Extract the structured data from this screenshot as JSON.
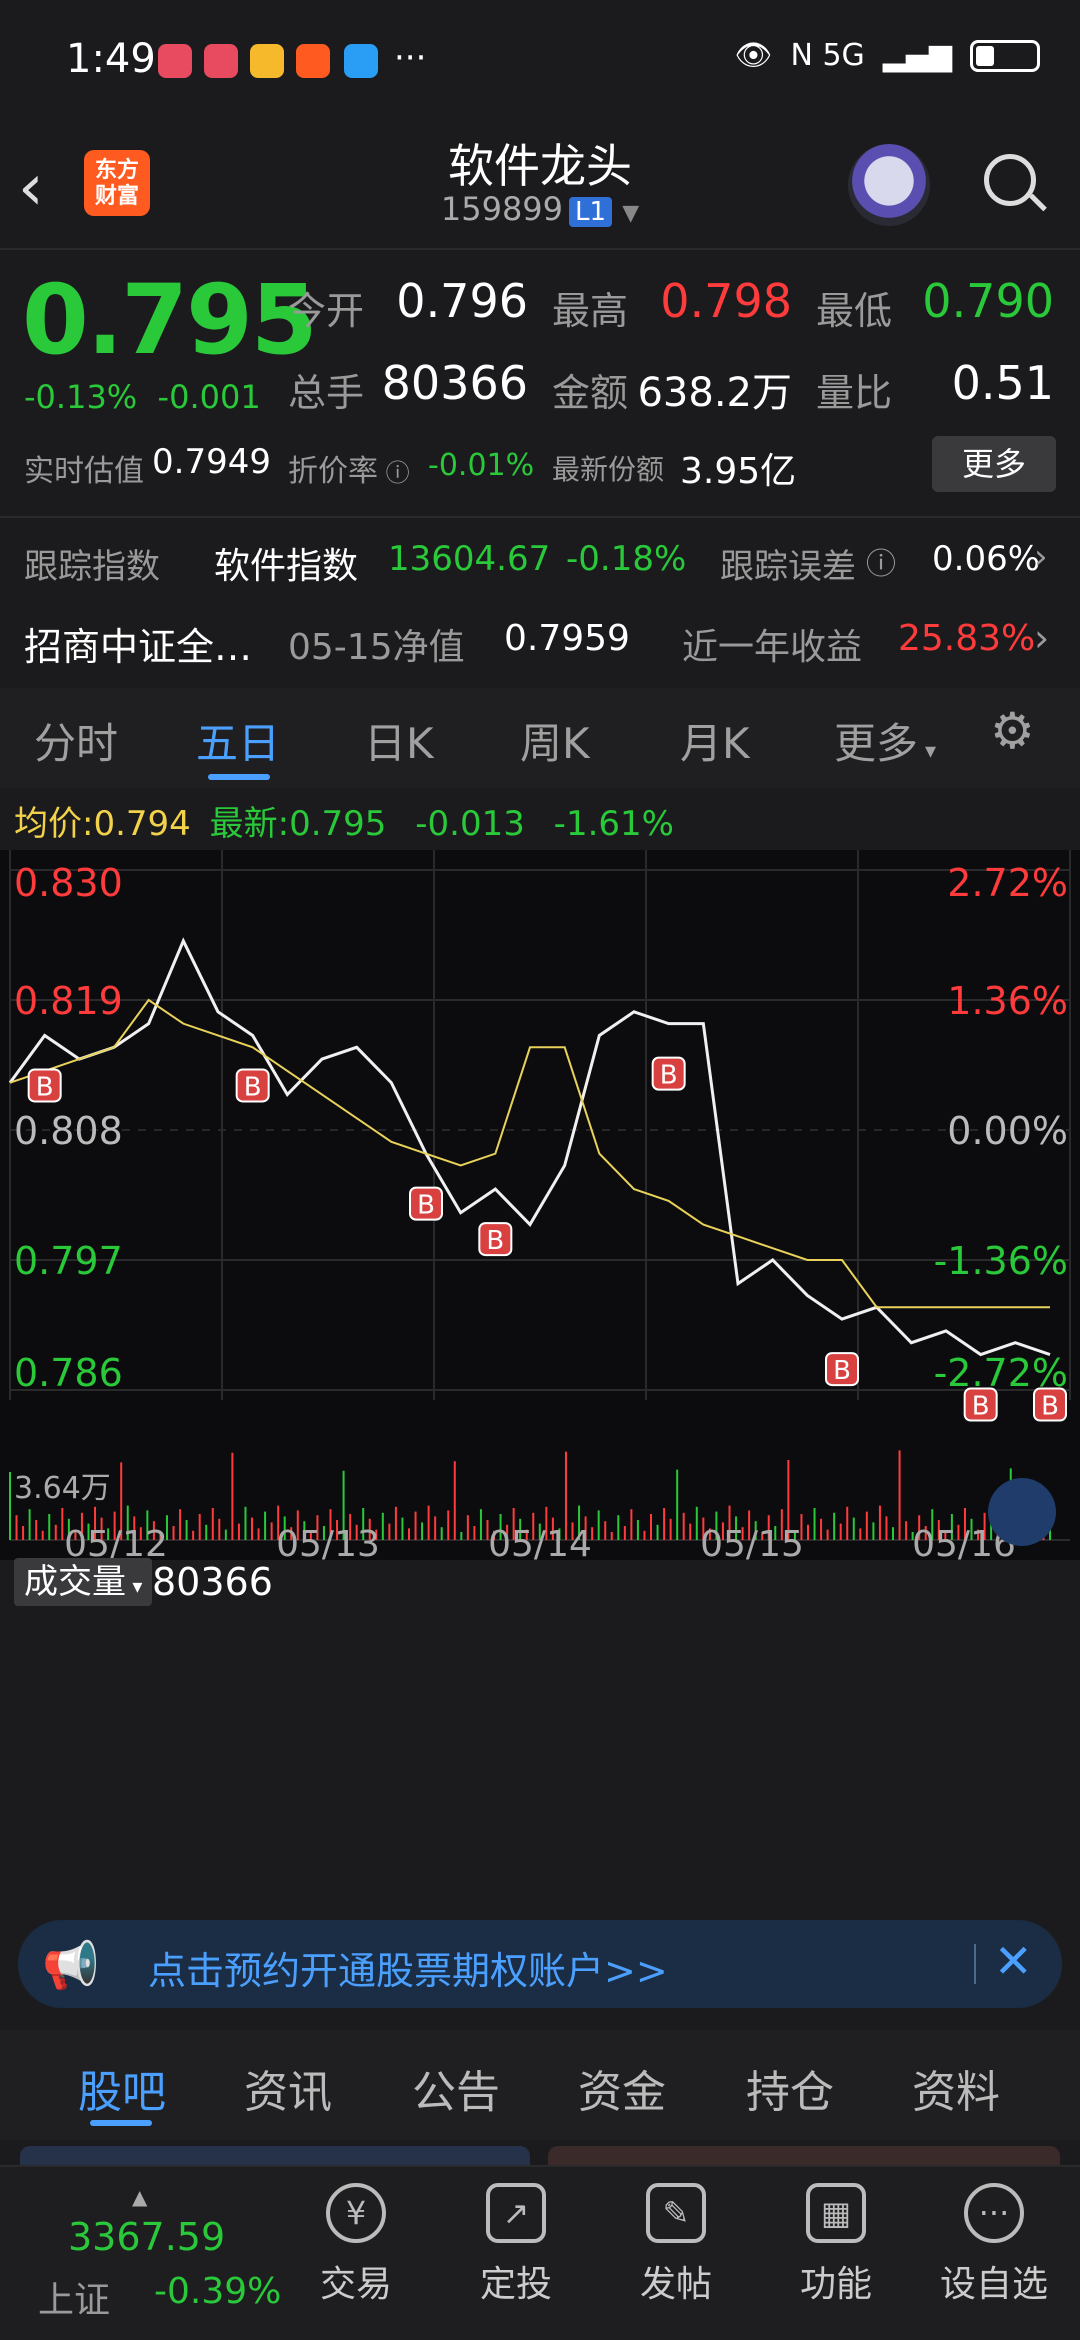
{
  "status": {
    "time": "1:49",
    "right_icons": "N  5G",
    "dots": "···"
  },
  "header": {
    "title": "软件龙头",
    "code": "159899",
    "level": "L1",
    "logo_line1": "东方",
    "logo_line2": "财富"
  },
  "quote": {
    "price": "0.795",
    "change_pct": "-0.13%",
    "change_abs": "-0.001",
    "open_label": "今开",
    "open": "0.796",
    "high_label": "最高",
    "high": "0.798",
    "low_label": "最低",
    "low": "0.790",
    "volume_label": "总手",
    "volume": "80366",
    "amount_label": "金额",
    "amount": "638.2万",
    "vol_ratio_label": "量比",
    "vol_ratio": "0.51",
    "iopv_label": "实时估值",
    "iopv": "0.7949",
    "discount_label": "折价率",
    "discount": "-0.01%",
    "shares_label": "最新份额",
    "shares": "3.95亿",
    "more": "更多"
  },
  "tracking": {
    "label": "跟踪指数",
    "index_name": "软件指数",
    "index_value": "13604.67",
    "index_change": "-0.18%",
    "error_label": "跟踪误差",
    "error_value": "0.06%"
  },
  "fund": {
    "name": "招商中证全…",
    "nav_label": "05-15净值",
    "nav": "0.7959",
    "yield_label": "近一年收益",
    "yield": "25.83%"
  },
  "chart_tabs": [
    "分时",
    "五日",
    "日K",
    "周K",
    "月K",
    "更多"
  ],
  "avg_row": {
    "avg_label": "均价:",
    "avg": "0.794",
    "latest_label": "最新:",
    "latest": "0.795",
    "chg": "-0.013",
    "chg_pct": "-1.61%"
  },
  "chart_data": {
    "type": "line",
    "y_labels_left": [
      "0.830",
      "0.819",
      "0.808",
      "0.797",
      "0.786"
    ],
    "y_labels_right": [
      "2.72%",
      "1.36%",
      "0.00%",
      "-1.36%",
      "-2.72%"
    ],
    "x_labels": [
      "05/12",
      "05/13",
      "05/14",
      "05/15",
      "05/16"
    ],
    "ylim": [
      0.786,
      0.83
    ],
    "baseline": 0.808,
    "series": [
      {
        "values": [
          0.812,
          0.816,
          0.814,
          0.815,
          0.817,
          0.824,
          0.818,
          0.816,
          0.811,
          0.814,
          0.815,
          0.812,
          0.806,
          0.801,
          0.803,
          0.8,
          0.805,
          0.816,
          0.818,
          0.817,
          0.817,
          0.795,
          0.797,
          0.794,
          0.792,
          0.793,
          0.79,
          0.791,
          0.789,
          0.79,
          0.789
        ]
      },
      {
        "values": [
          0.812,
          0.813,
          0.814,
          0.815,
          0.819,
          0.817,
          0.816,
          0.815,
          0.813,
          0.811,
          0.809,
          0.807,
          0.806,
          0.805,
          0.806,
          0.815,
          0.815,
          0.806,
          0.803,
          0.802,
          0.8,
          0.799,
          0.798,
          0.797,
          0.797,
          0.793,
          0.793,
          0.793,
          0.793,
          0.793,
          0.793
        ]
      }
    ],
    "markers": "B",
    "volume_label": "成交量",
    "volume_value": "80366",
    "volume_max_label": "3.64万"
  },
  "banner": {
    "text": "点击预约开通股票期权账户>>"
  },
  "bottom_tabs": [
    "股吧",
    "资讯",
    "公告",
    "资金",
    "持仓",
    "资料"
  ],
  "nav": {
    "index_value": "3367.59",
    "index_name": "上证",
    "index_chg": "-0.39%",
    "items": [
      "交易",
      "定投",
      "发帖",
      "功能",
      "设自选"
    ]
  }
}
